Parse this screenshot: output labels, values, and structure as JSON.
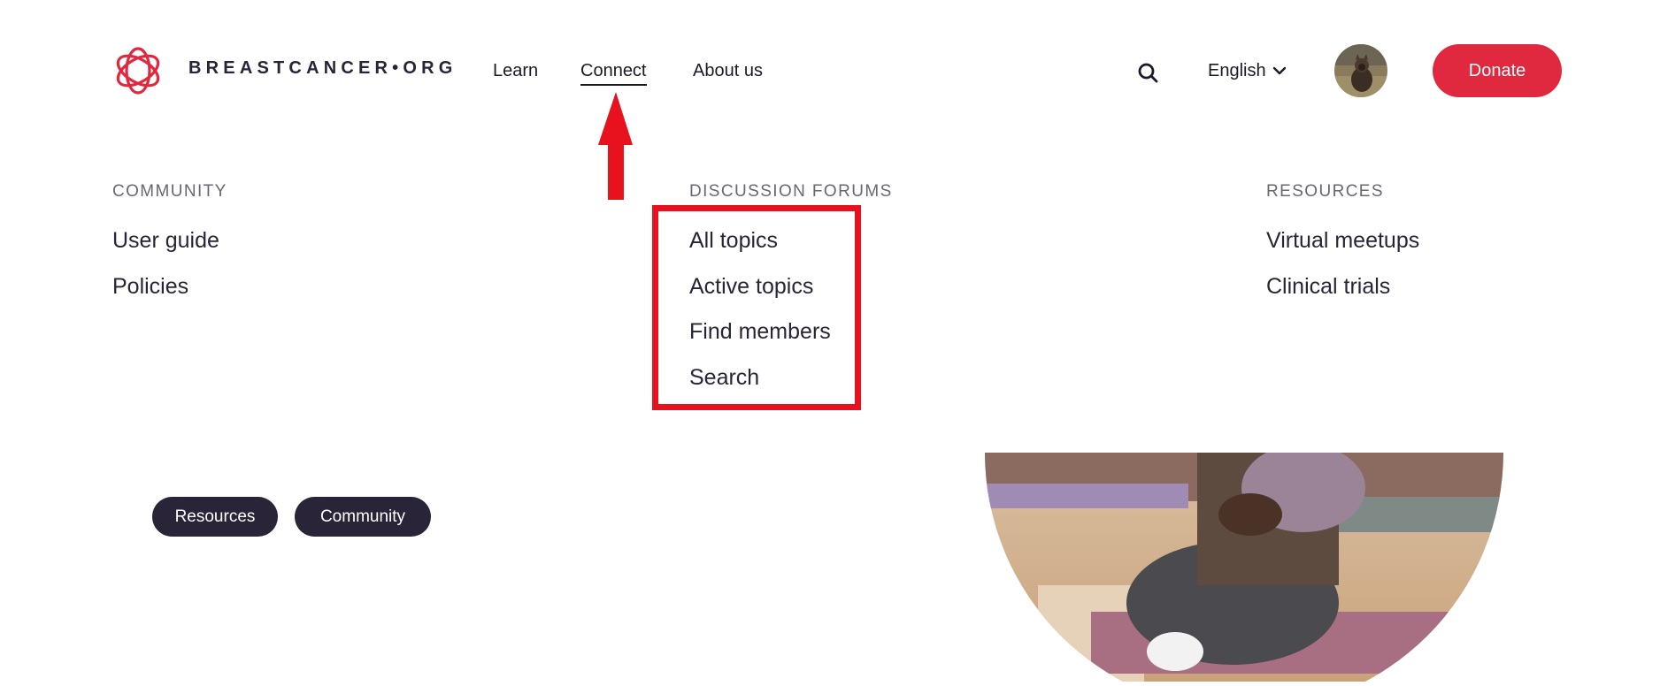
{
  "brand": {
    "logo_text": "BREASTCANCER•ORG",
    "accent_color": "#e0283f",
    "dark_color": "#2a2438"
  },
  "nav": {
    "items": [
      {
        "label": "Learn"
      },
      {
        "label": "Connect",
        "active": true
      },
      {
        "label": "About us"
      }
    ]
  },
  "header_right": {
    "search_icon": "search-icon",
    "language_label": "English",
    "language_icon": "chevron-down-icon",
    "donate_label": "Donate"
  },
  "mega_menu": {
    "columns": [
      {
        "heading": "COMMUNITY",
        "links": [
          "User guide",
          "Policies"
        ]
      },
      {
        "heading": "DISCUSSION FORUMS",
        "links": [
          "All topics",
          "Active topics",
          "Find members",
          "Search"
        ]
      },
      {
        "heading": "RESOURCES",
        "links": [
          "Virtual meetups",
          "Clinical trials"
        ]
      }
    ]
  },
  "annotations": {
    "highlight_color": "#e8121f",
    "arrow_color": "#e8121f"
  },
  "chips": [
    "Resources",
    "Community"
  ]
}
